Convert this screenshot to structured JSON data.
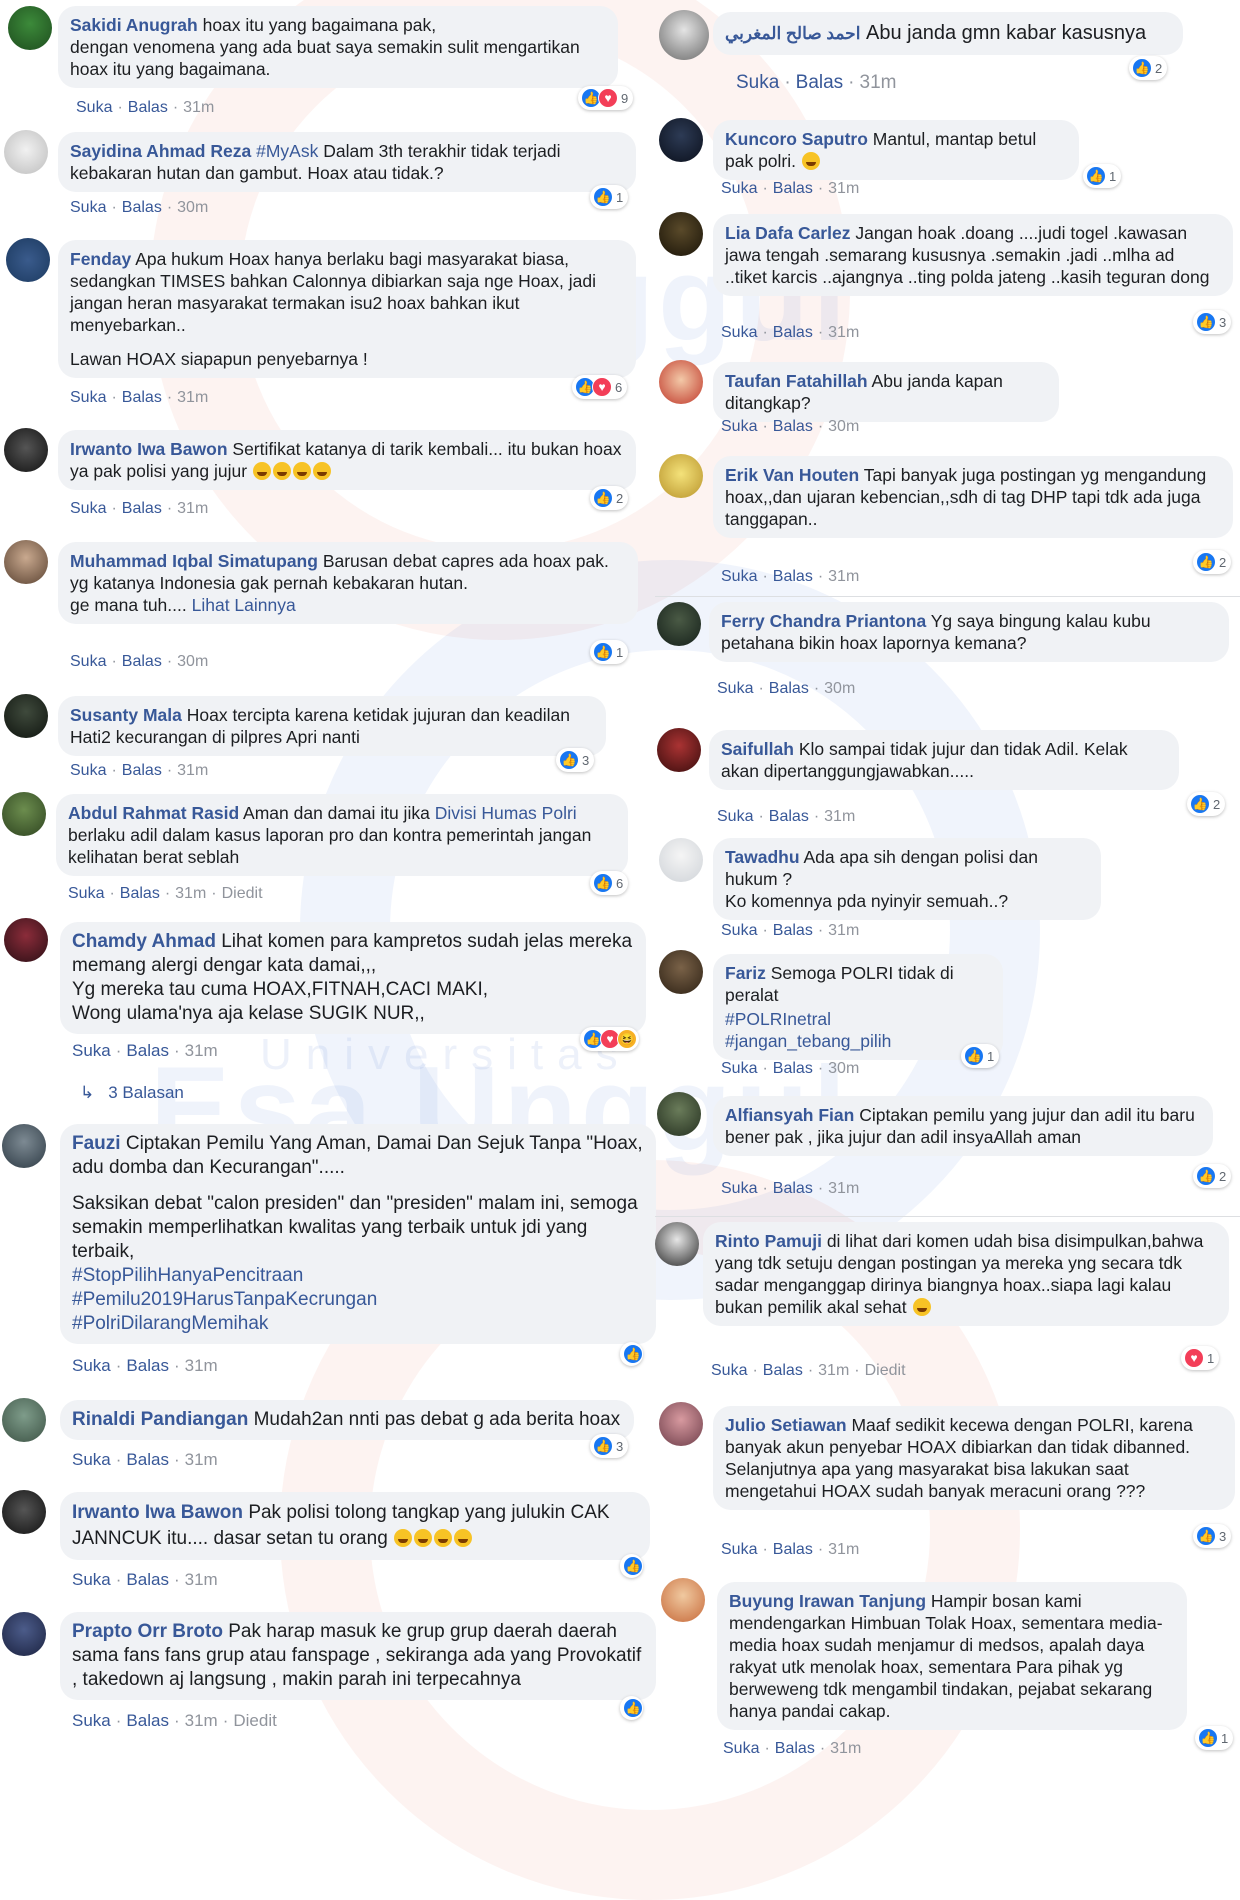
{
  "labels": {
    "like": "Suka",
    "reply": "Balas",
    "edited": "Diedit",
    "see_more": "Lihat Lainnya"
  },
  "watermark": {
    "big": "Esa Unggul",
    "small": "Universitas"
  },
  "colors": {
    "link": "#385898",
    "bubble": "#f0f2f5",
    "like": "#1877f2",
    "love": "#f33e58"
  },
  "left": [
    {
      "name": "Sakidi Anugrah",
      "text": "hoax itu yang bagaimana pak,\ndengan venomena yang ada buat saya semakin sulit mengartikan\nhoax itu yang bagaimana.",
      "time": "31m",
      "reactions": [
        "like",
        "love"
      ],
      "count": "9"
    },
    {
      "name": "Sayidina Ahmad Reza",
      "tag": "#MyAsk",
      "text": "Dalam 3th terakhir tidak terjadi kebakaran hutan dan gambut. Hoax atau tidak.?",
      "time": "30m",
      "reactions": [
        "like"
      ],
      "count": "1"
    },
    {
      "name": "Fenday",
      "text": "Apa hukum Hoax hanya berlaku bagi masyarakat biasa, sedangkan TIMSES bahkan Calonnya dibiarkan saja nge Hoax, jadi jangan heran masyarakat termakan isu2 hoax bahkan ikut menyebarkan..",
      "text2": "Lawan HOAX siapapun penyebarnya !",
      "time": "31m",
      "reactions": [
        "like",
        "love"
      ],
      "count": "6"
    },
    {
      "name": "Irwanto Iwa Bawon",
      "text": "Sertifikat katanya di tarik kembali... itu bukan hoax ya pak polisi yang jujur",
      "emoji": 4,
      "time": "31m",
      "reactions": [
        "like"
      ],
      "count": "2"
    },
    {
      "name": "Muhammad Iqbal Simatupang",
      "text": "Barusan debat capres ada hoax pak.\nyg katanya Indonesia gak pernah kebakaran hutan.\nge mana tuh....",
      "more": true,
      "time": "30m",
      "reactions": [
        "like"
      ],
      "count": "1"
    },
    {
      "name": "Susanty Mala",
      "text": "Hoax tercipta karena ketidak jujuran dan keadilan Hati2 kecurangan di pilpres Apri nanti",
      "time": "31m",
      "reactions": [
        "like"
      ],
      "count": "3"
    },
    {
      "name": "Abdul Rahmat Rasid",
      "text_a": "Aman dan damai itu jika",
      "link": "Divisi Humas Polri",
      "text_b": "berlaku adil dalam kasus laporan pro dan kontra pemerintah jangan kelihatan berat seblah",
      "time": "31m",
      "edited": true,
      "reactions": [
        "like"
      ],
      "count": "6"
    },
    {
      "name": "Chamdy Ahmad",
      "text": "Lihat komen para kampretos sudah jelas mereka memang alergi dengar kata damai,,,\nYg mereka tau cuma HOAX,FITNAH,CACI MAKI,\nWong ulama'nya aja kelase SUGIK NUR,,",
      "time": "31m",
      "reactions": [
        "like",
        "love",
        "haha"
      ],
      "count": ""
    },
    {
      "name": "Fauzi",
      "text": "Ciptakan Pemilu Yang Aman, Damai Dan Sejuk Tanpa \"Hoax, adu domba dan Kecurangan\".....",
      "text2": "Saksikan debat \"calon presiden\" dan \"presiden\" malam ini, semoga semakin memperlihatkan kwalitas yang terbaik untuk jdi yang terbaik,",
      "tags": "#StopPilihHanyaPencitraan\n#Pemilu2019HarusTanpaKecrungan\n#PolriDilarangMemihak",
      "time": "31m",
      "reactions": [
        "like"
      ],
      "count": ""
    },
    {
      "name": "Rinaldi Pandiangan",
      "text": "Mudah2an nnti pas debat g ada berita hoax",
      "time": "31m",
      "reactions": [
        "like"
      ],
      "count": "3"
    },
    {
      "name": "Irwanto Iwa Bawon",
      "text": "Pak polisi tolong tangkap yang julukin CAK JANNCUK itu.... dasar setan tu orang",
      "emoji": 4,
      "time": "31m",
      "reactions": [
        "like"
      ],
      "count": ""
    },
    {
      "name": "Prapto Orr Broto",
      "text": "Pak harap masuk ke grup grup daerah daerah sama fans fans grup atau fanspage , sekiranga ada yang Provokatif , takedown aj langsung , makin parah ini terpecahnya",
      "time": "31m",
      "edited": true,
      "reactions": [
        "like"
      ],
      "count": ""
    }
  ],
  "replies_link": "3 Balasan",
  "right": [
    {
      "name": "احمد صالح المغربي",
      "text": "Abu janda gmn kabar kasusnya",
      "time": "31m",
      "reactions": [
        "like"
      ],
      "count": "2"
    },
    {
      "name": "Kuncoro Saputro",
      "text": "Mantul, mantap betul pak polri.",
      "emoji": 1,
      "time": "31m",
      "reactions": [
        "like"
      ],
      "count": "1"
    },
    {
      "name": "Lia Dafa Carlez",
      "text": "Jangan hoak .doang ....judi togel .kawasan jawa tengah .semarang kususnya .semakin .jadi ..mlha ad ..tiket karcis ..ajangnya ..ting polda jateng ..kasih teguran dong",
      "time": "31m",
      "reactions": [
        "like"
      ],
      "count": "3"
    },
    {
      "name": "Taufan Fatahillah",
      "text": "Abu janda kapan ditangkap?",
      "time": "30m",
      "reactions": [],
      "count": ""
    },
    {
      "name": "Erik Van Houten",
      "text": "Tapi banyak juga postingan yg mengandung hoax,,dan ujaran kebencian,,sdh di tag DHP tapi tdk ada juga tanggapan..",
      "time": "31m",
      "reactions": [
        "like"
      ],
      "count": "2"
    },
    {
      "name": "Ferry Chandra Priantona",
      "text": "Yg saya bingung kalau kubu petahana bikin hoax lapornya kemana?",
      "time": "30m",
      "reactions": [],
      "count": ""
    },
    {
      "name": "Saifullah",
      "text": "Klo sampai tidak jujur dan tidak Adil. Kelak akan dipertanggungjawabkan.....",
      "time": "31m",
      "reactions": [
        "like"
      ],
      "count": "2"
    },
    {
      "name": "Tawadhu",
      "text": "Ada apa sih dengan polisi dan hukum ?\nKo komennya pda nyinyir semuah..?",
      "time": "31m",
      "reactions": [],
      "count": ""
    },
    {
      "name": "Fariz",
      "text": "Semoga POLRI tidak di peralat",
      "tags": "#POLRInetral\n#jangan_tebang_pilih",
      "time": "30m",
      "reactions": [
        "like"
      ],
      "count": "1"
    },
    {
      "name": "Alfiansyah Fian",
      "text": "Ciptakan pemilu yang jujur dan adil itu baru bener pak , jika jujur dan adil insyaAllah aman",
      "time": "31m",
      "reactions": [
        "like"
      ],
      "count": "2"
    },
    {
      "name": "Rinto Pamuji",
      "text": "di lihat dari komen udah bisa disimpulkan,bahwa yang tdk setuju dengan postingan ya mereka yng secara tdk sadar menganggap dirinya biangnya hoax..siapa lagi kalau bukan pemilik akal sehat",
      "emoji": 1,
      "time": "31m",
      "edited": true,
      "reactions": [
        "love"
      ],
      "count": "1"
    },
    {
      "name": "Julio Setiawan",
      "text": "Maaf sedikit kecewa dengan POLRI, karena banyak akun penyebar HOAX dibiarkan dan tidak dibanned. Selanjutnya apa yang masyarakat bisa lakukan saat mengetahui HOAX sudah banyak meracuni orang ???",
      "time": "31m",
      "reactions": [
        "like"
      ],
      "count": "3"
    },
    {
      "name": "Buyung Irawan Tanjung",
      "text": "Hampir bosan kami mendengarkan Himbuan Tolak Hoax, sementara media-media hoax sudah menjamur di medsos, apalah daya rakyat utk menolak hoax, sementara Para pihak yg berweweng tdk mengambil tindakan, pejabat sekarang hanya pandai cakap.",
      "time": "31m",
      "reactions": [
        "like"
      ],
      "count": "1"
    }
  ]
}
